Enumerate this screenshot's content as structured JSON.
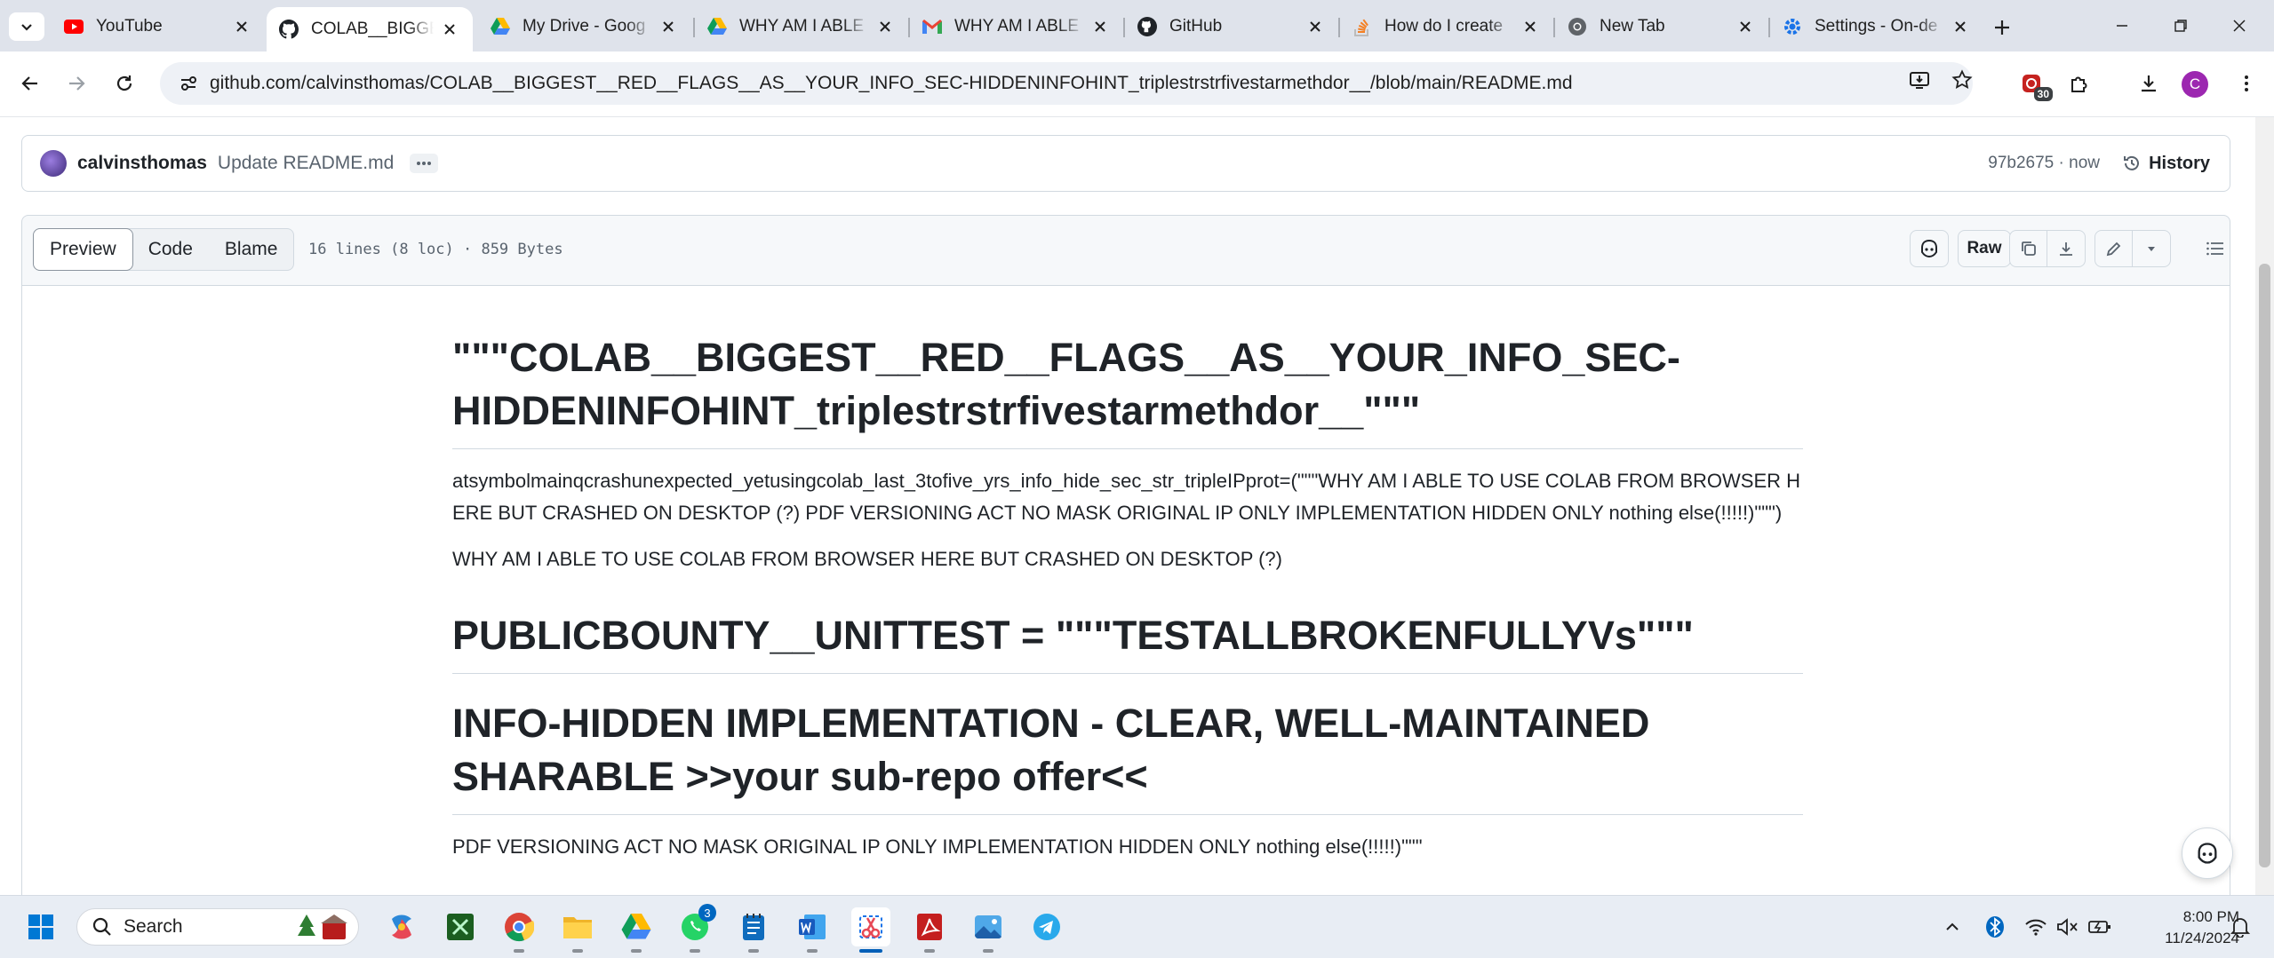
{
  "browser": {
    "tabs": [
      {
        "title": "YouTube",
        "icon": "youtube-icon"
      },
      {
        "title": "COLAB__BIGGEST",
        "icon": "github-icon",
        "active": true
      },
      {
        "title": "My Drive - Goog",
        "icon": "google-drive-icon"
      },
      {
        "title": "WHY AM I ABLE",
        "icon": "google-drive-icon"
      },
      {
        "title": "WHY AM I ABLE",
        "icon": "gmail-icon"
      },
      {
        "title": "GitHub",
        "icon": "github-icon"
      },
      {
        "title": "How do I create",
        "icon": "stackoverflow-icon"
      },
      {
        "title": "New Tab",
        "icon": "chrome-icon"
      },
      {
        "title": "Settings - On-de",
        "icon": "settings-icon"
      }
    ],
    "url": "github.com/calvinsthomas/COLAB__BIGGEST__RED__FLAGS__AS__YOUR_INFO_SEC-HIDDENINFOHINT_triplestrstrfivestarmethdor__/blob/main/README.md",
    "extension_badge": "30",
    "profile_initial": "C"
  },
  "commit": {
    "author": "calvinsthomas",
    "message": "Update README.md",
    "hash": "97b2675",
    "time": "now",
    "hash_time": "97b2675 · now",
    "history_label": "History"
  },
  "file_header": {
    "tabs": [
      "Preview",
      "Code",
      "Blame"
    ],
    "active_tab": "Preview",
    "meta": "16 lines (8 loc) · 859 Bytes",
    "raw_label": "Raw"
  },
  "readme": {
    "h1_title": "\"\"\"COLAB__BIGGEST__RED__FLAGS__AS__YOUR_INFO_SEC-HIDDENINFOHINT_triplestrstrfivestarmethdor__\"\"\"",
    "p1": "atsymbolmainqcrashunexpected_yetusingcolab_last_3tofive_yrs_info_hide_sec_str_tripleIPprot=(\"\"\"WHY AM I ABLE TO USE COLAB FROM BROWSER HERE BUT CRASHED ON DESKTOP (?) PDF VERSIONING ACT NO MASK ORIGINAL IP ONLY IMPLEMENTATION HIDDEN ONLY nothing else(!!!!!)\"\"\")",
    "p2": "WHY AM I ABLE TO USE COLAB FROM BROWSER HERE BUT CRASHED ON DESKTOP (?)",
    "h1_bounty": "PUBLICBOUNTY__UNITTEST = \"\"\"TESTALLBROKENFULLYVs\"\"\"",
    "h1_info": "INFO-HIDDEN IMPLEMENTATION - CLEAR, WELL-MAINTAINED SHARABLE >>your sub-repo offer<<",
    "p3_partial": "PDF VERSIONING ACT NO MASK ORIGINAL IP ONLY IMPLEMENTATION HIDDEN ONLY nothing else(!!!!!)\"\"\""
  },
  "taskbar": {
    "search_label": "Search",
    "whatsapp_badge": "3",
    "time": "8:00 PM",
    "date": "11/24/2024"
  },
  "colors": {
    "tabstrip": "#dfe3eb",
    "omnibox": "#eef1f6",
    "github_border": "#d1d9e0",
    "taskbar": "#e8edf4",
    "accent": "#005fb8"
  }
}
